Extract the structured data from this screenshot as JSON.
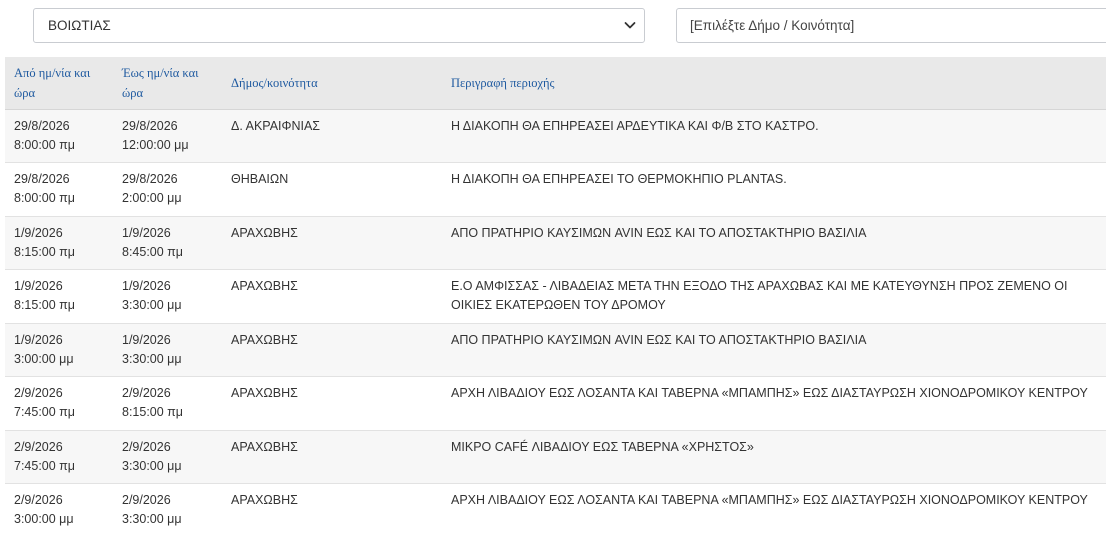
{
  "filters": {
    "region_selected": "ΒΟΙΩΤΙΑΣ",
    "municipality_placeholder": "[Επιλέξτε Δήμο / Κοινότητα]"
  },
  "table": {
    "headers": {
      "from_line1": "Από ημ/νία και",
      "from_line2": "ώρα",
      "to_line1": "Έως ημ/νία και",
      "to_line2": "ώρα",
      "municipality": "Δήμος/κοινότητα",
      "description": "Περιγραφή περιοχής"
    },
    "rows": [
      {
        "from_date": "29/8/2026",
        "from_time": "8:00:00 πμ",
        "to_date": "29/8/2026",
        "to_time": "12:00:00 μμ",
        "municipality": "Δ. ΑΚΡΑΙΦΝΙΑΣ",
        "desc_line1": "Η ΔΙΑΚΟΠΗ ΘΑ ΕΠΗΡΕΑΣΕΙ ΑΡΔΕΥΤΙΚΑ ΚΑΙ Φ/Β ΣΤΟ ΚΑΣΤΡΟ.",
        "desc_line2": ""
      },
      {
        "from_date": "29/8/2026",
        "from_time": "8:00:00 πμ",
        "to_date": "29/8/2026",
        "to_time": "2:00:00 μμ",
        "municipality": "ΘΗΒΑΙΩΝ",
        "desc_line1": "Η ΔΙΑΚΟΠΗ ΘΑ ΕΠΗΡΕΑΣΕΙ ΤΟ ΘΕΡΜΟΚΗΠΙΟ PLANTAS.",
        "desc_line2": ""
      },
      {
        "from_date": "1/9/2026",
        "from_time": "8:15:00 πμ",
        "to_date": "1/9/2026",
        "to_time": "8:45:00 πμ",
        "municipality": "ΑΡΑΧΩΒΗΣ",
        "desc_line1": "ΑΠΟ ΠΡΑΤΗΡΙΟ ΚΑΥΣΙΜΩΝ AVIN ΕΩΣ ΚΑΙ ΤΟ ΑΠΟΣΤΑΚΤΗΡΙΟ ΒΑΣΙΛΙΑ",
        "desc_line2": ""
      },
      {
        "from_date": "1/9/2026",
        "from_time": "8:15:00 πμ",
        "to_date": "1/9/2026",
        "to_time": "3:30:00 μμ",
        "municipality": "ΑΡΑΧΩΒΗΣ",
        "desc_line1": "Ε.Ο ΑΜΦΙΣΣΑΣ - ΛΙΒΑΔΕΙΑΣ ΜΕΤΑ ΤΗΝ ΕΞΟΔΟ ΤΗΣ ΑΡΑΧΩΒΑΣ ΚΑΙ ΜΕ ΚΑΤΕΥΘΥΝΣΗ ΠΡΟΣ ΖΕΜΕΝΟ ΟΙ",
        "desc_line2": "ΟΙΚΙΕΣ ΕΚΑΤΕΡΩΘΕΝ ΤΟΥ ΔΡΟΜΟΥ"
      },
      {
        "from_date": "1/9/2026",
        "from_time": "3:00:00 μμ",
        "to_date": "1/9/2026",
        "to_time": "3:30:00 μμ",
        "municipality": "ΑΡΑΧΩΒΗΣ",
        "desc_line1": "ΑΠΟ ΠΡΑΤΗΡΙΟ ΚΑΥΣΙΜΩΝ AVIN ΕΩΣ ΚΑΙ ΤΟ ΑΠΟΣΤΑΚΤΗΡΙΟ ΒΑΣΙΛΙΑ",
        "desc_line2": ""
      },
      {
        "from_date": "2/9/2026",
        "from_time": "7:45:00 πμ",
        "to_date": "2/9/2026",
        "to_time": "8:15:00 πμ",
        "municipality": "ΑΡΑΧΩΒΗΣ",
        "desc_line1": "ΑΡΧΗ ΛΙΒΑΔΙΟΥ ΕΩΣ ΛΟΣΑΝΤΑ ΚΑΙ ΤΑΒΕΡΝΑ «ΜΠΑΜΠΗΣ» ΕΩΣ ΔΙΑΣΤΑΥΡΩΣΗ ΧΙΟΝΟΔΡΟΜΙΚΟΥ ΚΕΝΤΡΟΥ",
        "desc_line2": ""
      },
      {
        "from_date": "2/9/2026",
        "from_time": "7:45:00 πμ",
        "to_date": "2/9/2026",
        "to_time": "3:30:00 μμ",
        "municipality": "ΑΡΑΧΩΒΗΣ",
        "desc_line1": "ΜΙΚΡΟ CAFÉ ΛΙΒΑΔΙΟΥ ΕΩΣ ΤΑΒΕΡΝΑ «ΧΡΗΣΤΟΣ»",
        "desc_line2": ""
      },
      {
        "from_date": "2/9/2026",
        "from_time": "3:00:00 μμ",
        "to_date": "2/9/2026",
        "to_time": "3:30:00 μμ",
        "municipality": "ΑΡΑΧΩΒΗΣ",
        "desc_line1": "ΑΡΧΗ ΛΙΒΑΔΙΟΥ ΕΩΣ ΛΟΣΑΝΤΑ ΚΑΙ ΤΑΒΕΡΝΑ «ΜΠΑΜΠΗΣ» ΕΩΣ ΔΙΑΣΤΑΥΡΩΣΗ ΧΙΟΝΟΔΡΟΜΙΚΟΥ ΚΕΝΤΡΟΥ",
        "desc_line2": ""
      }
    ]
  }
}
